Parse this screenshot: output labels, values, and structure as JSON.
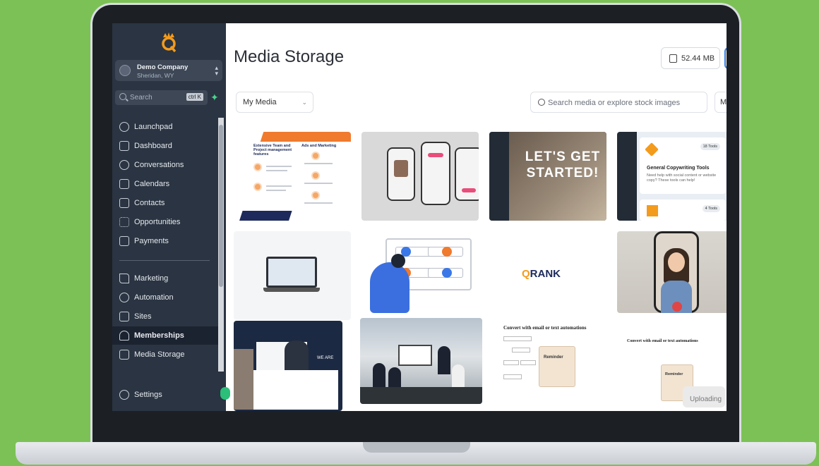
{
  "app": {
    "brand": "Q",
    "company_name": "Demo Company",
    "company_location": "Sheridan, WY",
    "search_placeholder": "Search",
    "search_shortcut": "ctrl K"
  },
  "sidebar": {
    "items": [
      {
        "label": "Launchpad",
        "icon": "rocket-icon"
      },
      {
        "label": "Dashboard",
        "icon": "grid-icon"
      },
      {
        "label": "Conversations",
        "icon": "chat-icon"
      },
      {
        "label": "Calendars",
        "icon": "calendar-icon"
      },
      {
        "label": "Contacts",
        "icon": "contacts-icon"
      },
      {
        "label": "Opportunities",
        "icon": "funnel-icon"
      },
      {
        "label": "Payments",
        "icon": "receipt-icon"
      },
      {
        "label": "Marketing",
        "icon": "send-icon"
      },
      {
        "label": "Automation",
        "icon": "automation-icon"
      },
      {
        "label": "Sites",
        "icon": "browser-icon"
      },
      {
        "label": "Memberships",
        "icon": "award-icon"
      },
      {
        "label": "Media Storage",
        "icon": "image-icon"
      }
    ],
    "settings_label": "Settings",
    "active": "Memberships"
  },
  "main": {
    "title": "Media Storage",
    "storage_used": "52.44 MB",
    "filter_value": "My Media",
    "search_placeholder": "Search media or explore stock images",
    "filter2_partial": "M",
    "uploading_label": "Uploading"
  },
  "cards": {
    "c1_heading": "Extensive Team and Project management features",
    "c1_heading2": "Ads and Marketing",
    "c3_text": "LET'S GET STARTED!",
    "c4_title": "General Copywriting Tools",
    "c4_sub": "Need help with social content or website copy? These tools can help!",
    "c4_badge": "18 Tools",
    "c4_badge2": "4 Tools",
    "c7_logo": "RANK",
    "c9_text": "WE ARE",
    "c11_title": "Convert with email or text automations",
    "c11_reminder": "Reminder",
    "c12_title": "Convert with email or text automations",
    "c12_reminder": "Reminder"
  },
  "colors": {
    "sidebar_bg": "#2a3442",
    "accent_orange": "#f07a2e",
    "accent_blue": "#2f80ed",
    "background_green": "#7cc155"
  }
}
